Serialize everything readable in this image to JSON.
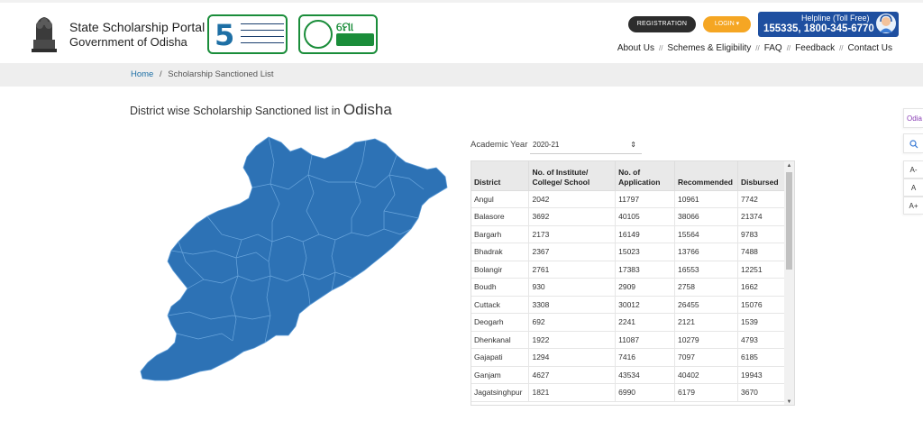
{
  "header": {
    "portal_title": "State Scholarship Portal",
    "portal_subtitle": "Government of Odisha",
    "logo_5t_text": "TRANSPARENCY TECHNOLOGY TEAMWORK TIME TRANSFORMATION",
    "logo_mo_text": "ମୋ ସରକାର",
    "registration_label": "REGISTRATION",
    "login_label": "LOGIN",
    "helpline_title": "Helpline (Toll Free)",
    "helpline_numbers": "155335, 1800-345-6770",
    "nav": [
      "About Us",
      "Schemes & Eligibility",
      "FAQ",
      "Feedback",
      "Contact Us"
    ],
    "nav_separator": "//"
  },
  "breadcrumb": {
    "home": "Home",
    "separator": "/",
    "current": "Scholarship Sanctioned List"
  },
  "page": {
    "heading": "District wise Scholarship Sanctioned list in",
    "state": "Odisha"
  },
  "filter": {
    "label": "Academic Year",
    "selected": "2020-21"
  },
  "table": {
    "columns": [
      "District",
      "No. of Institute/ College/ School",
      "No. of Application",
      "Recommended",
      "Disbursed"
    ],
    "rows": [
      [
        "Angul",
        "2042",
        "11797",
        "10961",
        "7742"
      ],
      [
        "Balasore",
        "3692",
        "40105",
        "38066",
        "21374"
      ],
      [
        "Bargarh",
        "2173",
        "16149",
        "15564",
        "9783"
      ],
      [
        "Bhadrak",
        "2367",
        "15023",
        "13766",
        "7488"
      ],
      [
        "Bolangir",
        "2761",
        "17383",
        "16553",
        "12251"
      ],
      [
        "Boudh",
        "930",
        "2909",
        "2758",
        "1662"
      ],
      [
        "Cuttack",
        "3308",
        "30012",
        "26455",
        "15076"
      ],
      [
        "Deogarh",
        "692",
        "2241",
        "2121",
        "1539"
      ],
      [
        "Dhenkanal",
        "1922",
        "11087",
        "10279",
        "4793"
      ],
      [
        "Gajapati",
        "1294",
        "7416",
        "7097",
        "6185"
      ],
      [
        "Ganjam",
        "4627",
        "43534",
        "40402",
        "19943"
      ],
      [
        "Jagatsinghpur",
        "1821",
        "6990",
        "6179",
        "3670"
      ]
    ]
  },
  "side_tools": {
    "language": "Odia",
    "font_small": "A-",
    "font_normal": "A",
    "font_large": "A+"
  },
  "colors": {
    "map_fill": "#2d72b5",
    "header_button_dark": "#2c2c2c",
    "login_orange": "#f5a623",
    "helpline_blue": "#1e4fa0",
    "logo_green": "#1a8d3a"
  }
}
